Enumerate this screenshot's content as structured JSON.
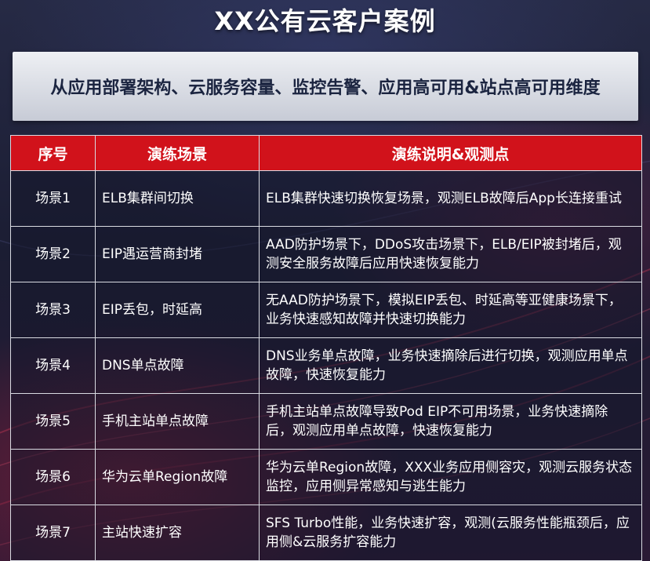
{
  "title": "XX公有云客户案例",
  "subtitle": "从应用部署架构、云服务容量、监控告警、应用高可用&站点高可用维度",
  "table": {
    "headers": [
      "序号",
      "演练场景",
      "演练说明&观测点"
    ],
    "rows": [
      {
        "id": "场景1",
        "scene": "ELB集群间切换",
        "desc": "ELB集群快速切换恢复场景，观测ELB故障后App长连接重试"
      },
      {
        "id": "场景2",
        "scene": "EIP遇运营商封堵",
        "desc": "AAD防护场景下，DDoS攻击场景下，ELB/EIP被封堵后，观测安全服务故障后应用快速恢复能力"
      },
      {
        "id": "场景3",
        "scene": "EIP丢包，时延高",
        "desc": "无AAD防护场景下，模拟EIP丢包、时延高等亚健康场景下，业务快速感知故障并快速切换能力"
      },
      {
        "id": "场景4",
        "scene": "DNS单点故障",
        "desc": "DNS业务单点故障，业务快速摘除后进行切换，观测应用单点故障，快速恢复能力"
      },
      {
        "id": "场景5",
        "scene": "手机主站单点故障",
        "desc": "手机主站单点故障导致Pod EIP不可用场景，业务快速摘除后，观测应用单点故障，快速恢复能力"
      },
      {
        "id": "场景6",
        "scene": "华为云单Region故障",
        "desc": "华为云单Region故障，XXX业务应用侧容灾，观测云服务状态监控，应用侧异常感知与逃生能力"
      },
      {
        "id": "场景7",
        "scene": "主站快速扩容",
        "desc": "SFS Turbo性能，业务快速扩容，观测(云服务性能瓶颈后，应用侧&云服务扩容能力"
      }
    ]
  },
  "colors": {
    "header_bg": "#d1121b",
    "subtitle_text": "#1b2440"
  }
}
